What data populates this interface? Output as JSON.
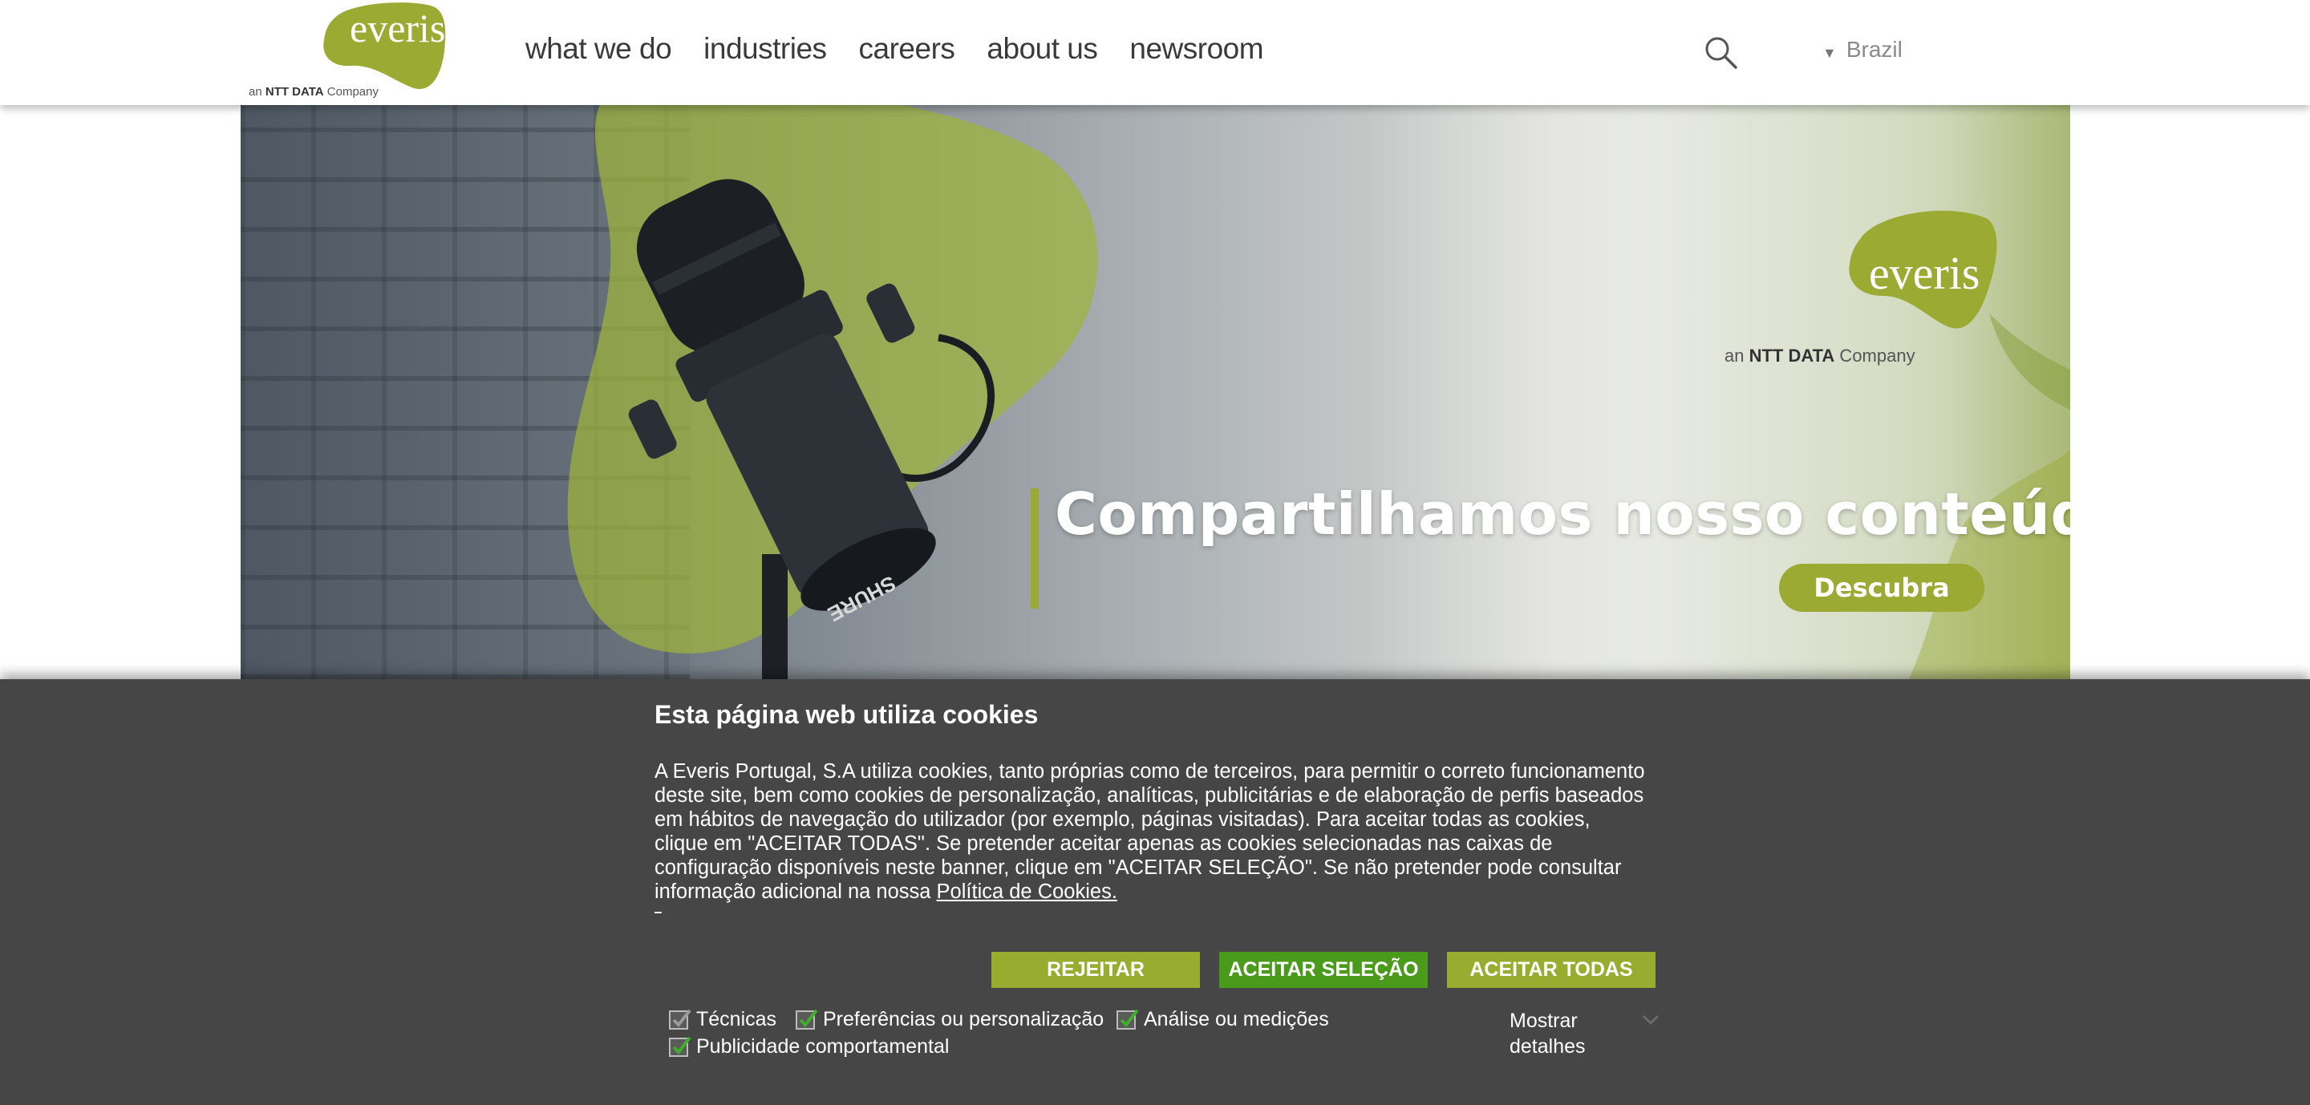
{
  "header": {
    "logo_word": "everis",
    "logo_tag_prefix": "an ",
    "logo_tag_brand": "NTT DATA",
    "logo_tag_suffix": " Company",
    "nav": [
      "what we do",
      "industries",
      "careers",
      "about us",
      "newsroom"
    ],
    "search_icon": "search-icon",
    "country": "Brazil"
  },
  "hero": {
    "logo_word": "everis",
    "logo_tag_prefix": "an ",
    "logo_tag_brand": "NTT DATA",
    "logo_tag_suffix": " Company",
    "mic_brand": "SHURE",
    "headline": "Compartilhamos nosso conteúdo",
    "cta": "Descubra"
  },
  "cookies": {
    "title": "Esta página web utiliza cookies",
    "body": "A Everis Portugal, S.A utiliza cookies, tanto próprias como de terceiros, para permitir o correto funcionamento deste site, bem como cookies de personalização, analíticas, publicitárias e de elaboração de perfis baseados em hábitos de navegação do utilizador (por exemplo, páginas visitadas). Para aceitar todas as cookies, clique em \"ACEITAR TODAS\". Se pretender aceitar apenas as cookies selecionadas nas caixas de configuração disponíveis neste banner, clique em \"ACEITAR SELEÇÃO\". Se não pretender pode consultar informação adicional na nossa ",
    "policy_link": "Política de Cookies. ",
    "buttons": {
      "reject": "REJEITAR",
      "accept_selection": "ACEITAR SELEÇÃO",
      "accept_all": "ACEITAR TODAS"
    },
    "options": [
      {
        "label": "Técnicas",
        "checked": true,
        "disabled": true
      },
      {
        "label": "Preferências ou personalização",
        "checked": true,
        "disabled": false
      },
      {
        "label": "Análise ou medições",
        "checked": true,
        "disabled": false
      },
      {
        "label": "Publicidade comportamental",
        "checked": true,
        "disabled": false
      }
    ],
    "details_label": "Mostrar detalhes"
  },
  "colors": {
    "brand_green": "#9aaa32",
    "accept_selection_green": "#4a9b1c",
    "banner_bg": "#464646",
    "check_green": "#3fae2a",
    "check_grey": "#9a9a9a"
  }
}
